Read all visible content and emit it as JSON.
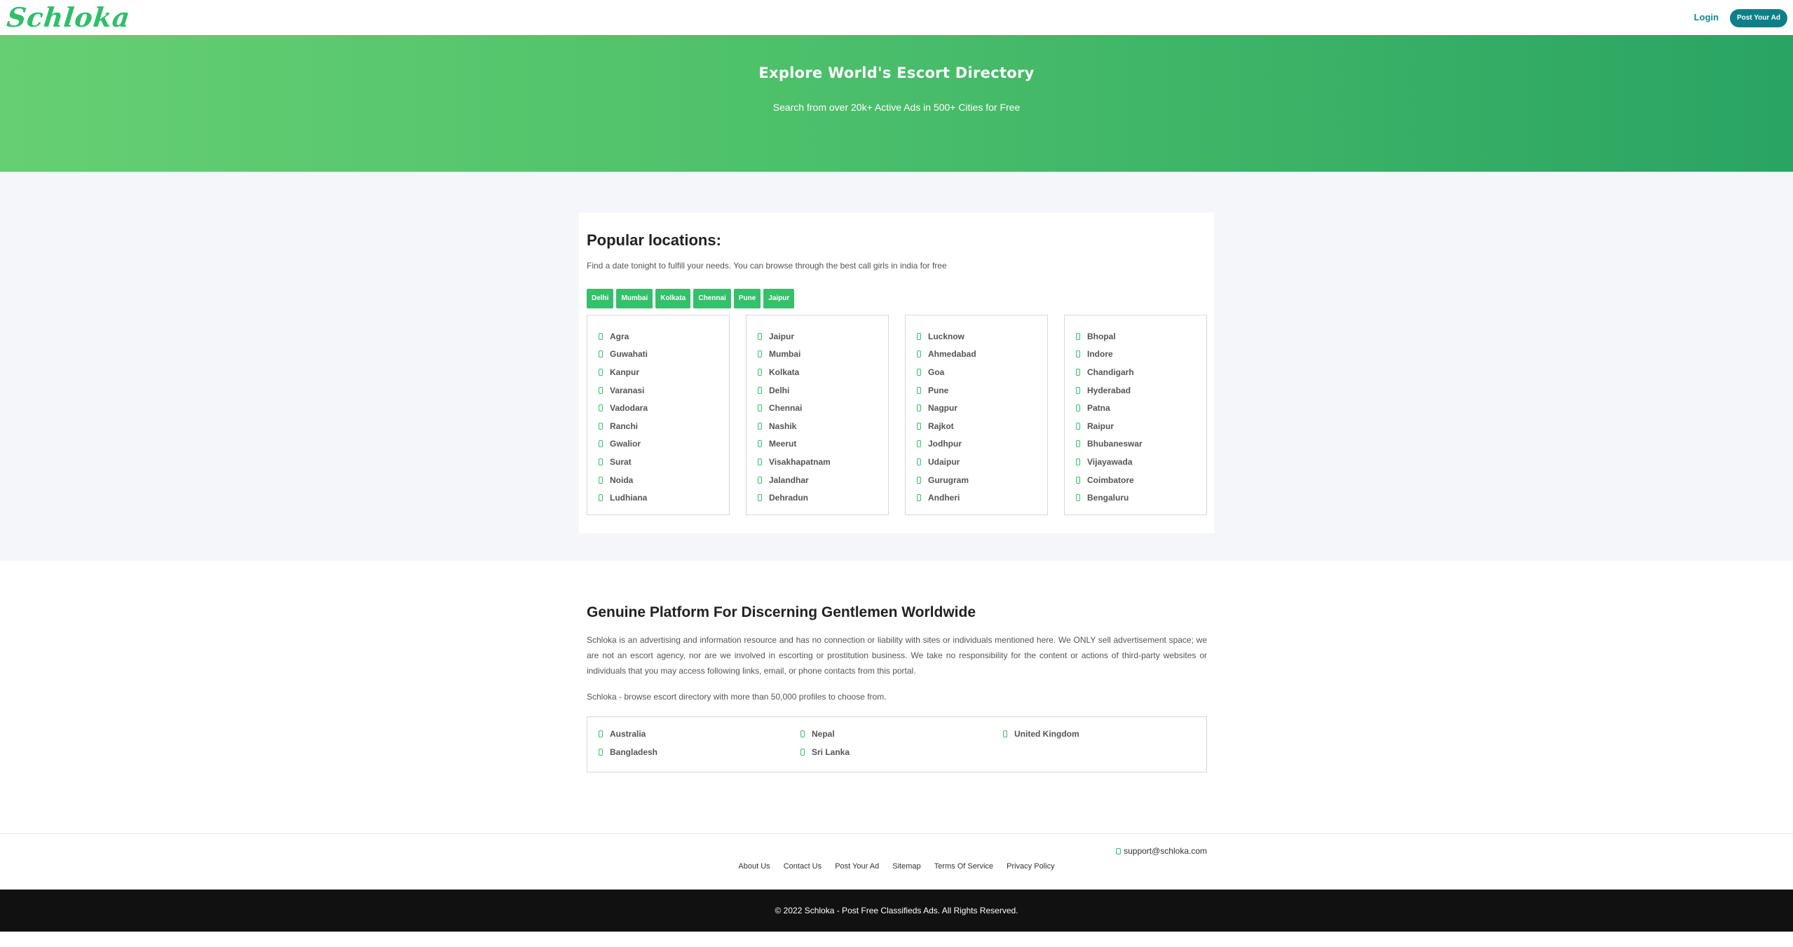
{
  "header": {
    "logo": "Schloka",
    "login_label": "Login",
    "post_ad_label": "Post Your Ad"
  },
  "hero": {
    "title": "Explore World's Escort Directory",
    "subtitle": "Search from over 20k+ Active Ads in 500+ Cities for Free"
  },
  "locations": {
    "title": "Popular locations:",
    "description": "Find a date tonight to fulfill your needs. You can browse through the best call girls in india for free",
    "tags": [
      "Delhi",
      "Mumbai",
      "Kolkata",
      "Chennai",
      "Pune",
      "Jaipur"
    ],
    "columns": [
      [
        "Agra",
        "Guwahati",
        "Kanpur",
        "Varanasi",
        "Vadodara",
        "Ranchi",
        "Gwalior",
        "Surat",
        "Noida",
        "Ludhiana"
      ],
      [
        "Jaipur",
        "Mumbai",
        "Kolkata",
        "Delhi",
        "Chennai",
        "Nashik",
        "Meerut",
        "Visakhapatnam",
        "Jalandhar",
        "Dehradun"
      ],
      [
        "Lucknow",
        "Ahmedabad",
        "Goa",
        "Pune",
        "Nagpur",
        "Rajkot",
        "Jodhpur",
        "Udaipur",
        "Gurugram",
        "Andheri"
      ],
      [
        "Bhopal",
        "Indore",
        "Chandigarh",
        "Hyderabad",
        "Patna",
        "Raipur",
        "Bhubaneswar",
        "Vijayawada",
        "Coimbatore",
        "Bengaluru"
      ]
    ]
  },
  "genuine": {
    "title": "Genuine Platform For Discerning Gentlemen Worldwide",
    "paragraph": "Schloka is an advertising and information resource and has no connection or liability with sites or individuals mentioned here. We ONLY sell advertisement space; we are not an escort agency, nor are we involved in escorting or prostitution business. We take no responsibility for the content or actions of third-party websites or individuals that you may access following links, email, or phone contacts from this portal.",
    "paragraph2": "Schloka - browse escort directory with more than 50,000 profiles to choose from.",
    "countries": [
      "Australia",
      "Nepal",
      "United Kingdom",
      "Bangladesh",
      "Sri Lanka"
    ]
  },
  "footer": {
    "support_email": "support@schloka.com",
    "links": [
      "About Us",
      "Contact Us",
      "Post Your Ad",
      "Sitemap",
      "Terms Of Service",
      "Privacy Policy"
    ],
    "copyright": "© 2022 Schloka - Post Free Classifieds Ads. All Rights Reserved."
  },
  "colors": {
    "brand_green": "#35c06b",
    "teal": "#0e7f87",
    "hero_gradient_start": "#66cf73",
    "hero_gradient_end": "#2aa463"
  },
  "icons": {
    "city_marker": "map-pin-icon",
    "support": "envelope-icon"
  }
}
